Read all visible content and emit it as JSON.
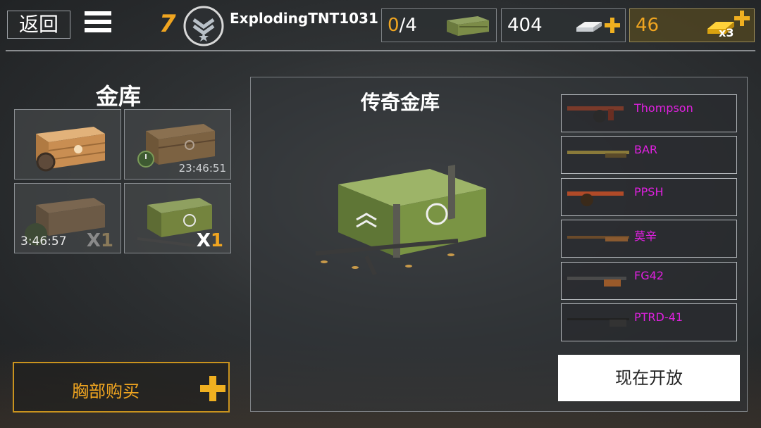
{
  "header": {
    "back_label": "返回",
    "level": "7",
    "player_name": "ExplodingTNT1031",
    "crates": {
      "current": "0",
      "sep_max": "/4"
    },
    "silver": "404",
    "gold": "46",
    "gold_multiplier": "x3"
  },
  "vault": {
    "title": "金库",
    "slots": [
      {
        "timer": "",
        "count_x": "",
        "count_n": ""
      },
      {
        "timer": "23:46:51",
        "count_x": "",
        "count_n": ""
      },
      {
        "timer": "3:46:57",
        "count_x": "X",
        "count_n": "1"
      },
      {
        "timer": "",
        "count_x": "X",
        "count_n": "1"
      }
    ],
    "buy_label": "胸部购买"
  },
  "main": {
    "title": "传奇金库",
    "weapons": [
      "Thompson",
      "BAR",
      "PPSH",
      "莫辛",
      "FG42",
      "PTRD-41"
    ],
    "open_label": "现在开放"
  },
  "colors": {
    "accent": "#f0a520",
    "weapon_name": "#e020e0"
  },
  "icons": [
    "menu-icon",
    "rank-chevron-icon",
    "ammo-crate-icon",
    "silver-bar-icon",
    "gold-bar-icon",
    "plus-icon"
  ]
}
